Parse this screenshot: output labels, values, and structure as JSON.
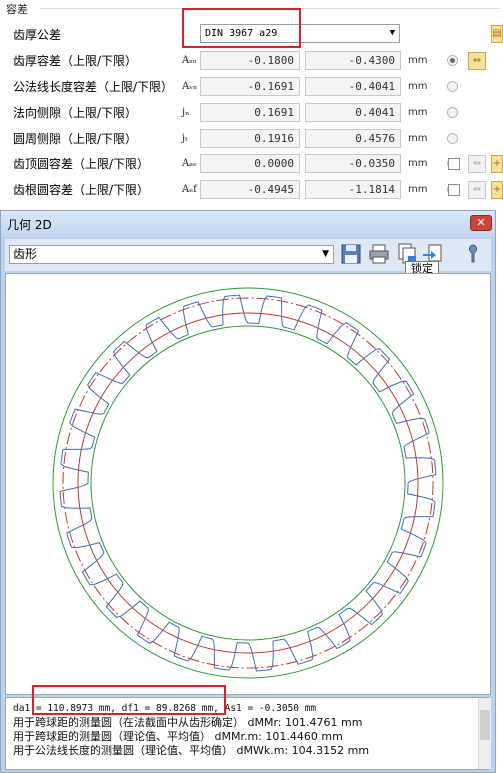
{
  "section": {
    "title": "容差"
  },
  "tooth_tolerance": {
    "label": "齿厚公差",
    "value": "DIN 3967 a29"
  },
  "rows": [
    {
      "label": "齿厚容差（上限/下限）",
      "symbol": "Aₛₙ",
      "upper": "-0.1800",
      "lower": "-0.4300",
      "unit": "mm",
      "selected": true
    },
    {
      "label": "公法线长度容差（上限/下限）",
      "symbol": "Aᵥₙ",
      "upper": "-0.1691",
      "lower": "-0.4041",
      "unit": "mm",
      "selected": false
    },
    {
      "label": "法向侧隙（上限/下限）",
      "symbol": "jₙ",
      "upper": "0.1691",
      "lower": "0.4041",
      "unit": "mm",
      "selected": false
    },
    {
      "label": "圆周侧隙（上限/下限）",
      "symbol": "jₜ",
      "upper": "0.1916",
      "lower": "0.4576",
      "unit": "mm",
      "selected": false
    },
    {
      "label": "齿顶圆容差（上限/下限）",
      "symbol": "Aₐₑ",
      "upper": "0.0000",
      "lower": "-0.0350",
      "unit": "mm",
      "selected": false
    },
    {
      "label": "齿根圆容差（上限/下限）",
      "symbol": "Aₑf",
      "upper": "-0.4945",
      "lower": "-1.1814",
      "unit": "mm",
      "selected": false
    }
  ],
  "window": {
    "title": "几何 2D",
    "close": "✕",
    "view_select": "齿形",
    "tooltip": "锁定",
    "output_lines": [
      "da1 = 110.8973 mm, df1 = 89.8268 mm, As1 = -0.3050 mm",
      "用于跨球距的测量圆（在法截面中从齿形确定） dMMr: 101.4761 mm",
      "用于跨球距的测量圆（理论值、平均值） dMMr.m: 101.4460 mm",
      "用于公法线长度的测量圆（理论值、平均值） dMWk.m: 104.3152 mm"
    ]
  },
  "colors": {
    "outer_circle": "#2e9b3a",
    "pitch_circle": "#c0392b",
    "tooth_profile": "#3f6fb5",
    "highlight": "#d9232a"
  }
}
